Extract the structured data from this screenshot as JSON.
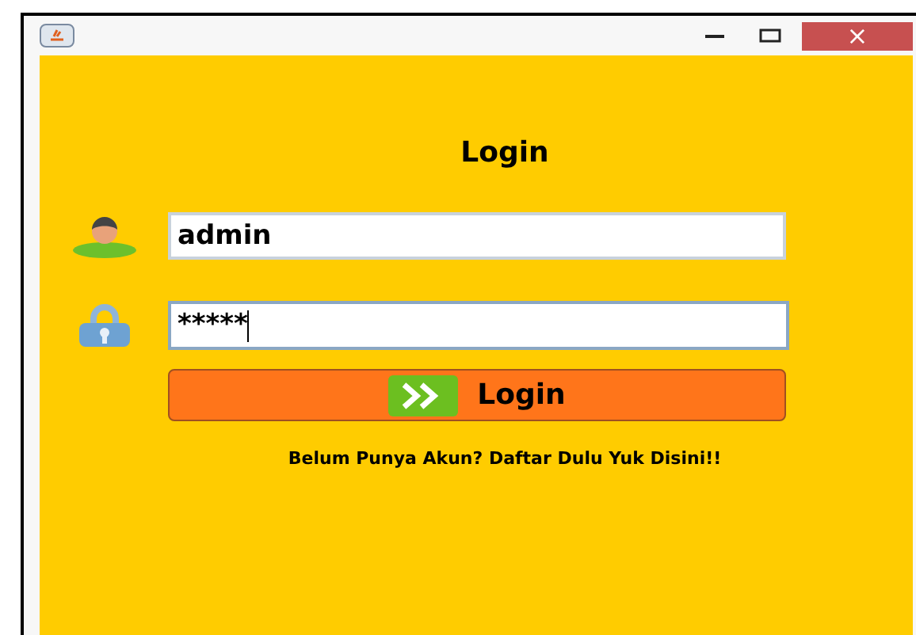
{
  "window": {
    "title_bar": {
      "close": "×"
    }
  },
  "form": {
    "title": "Login",
    "username": {
      "value": "admin"
    },
    "password": {
      "value": "*****",
      "focused": true
    },
    "login_button": {
      "label": "Login"
    },
    "register_link": "Belum Punya Akun? Daftar Dulu Yuk Disini!!"
  }
}
